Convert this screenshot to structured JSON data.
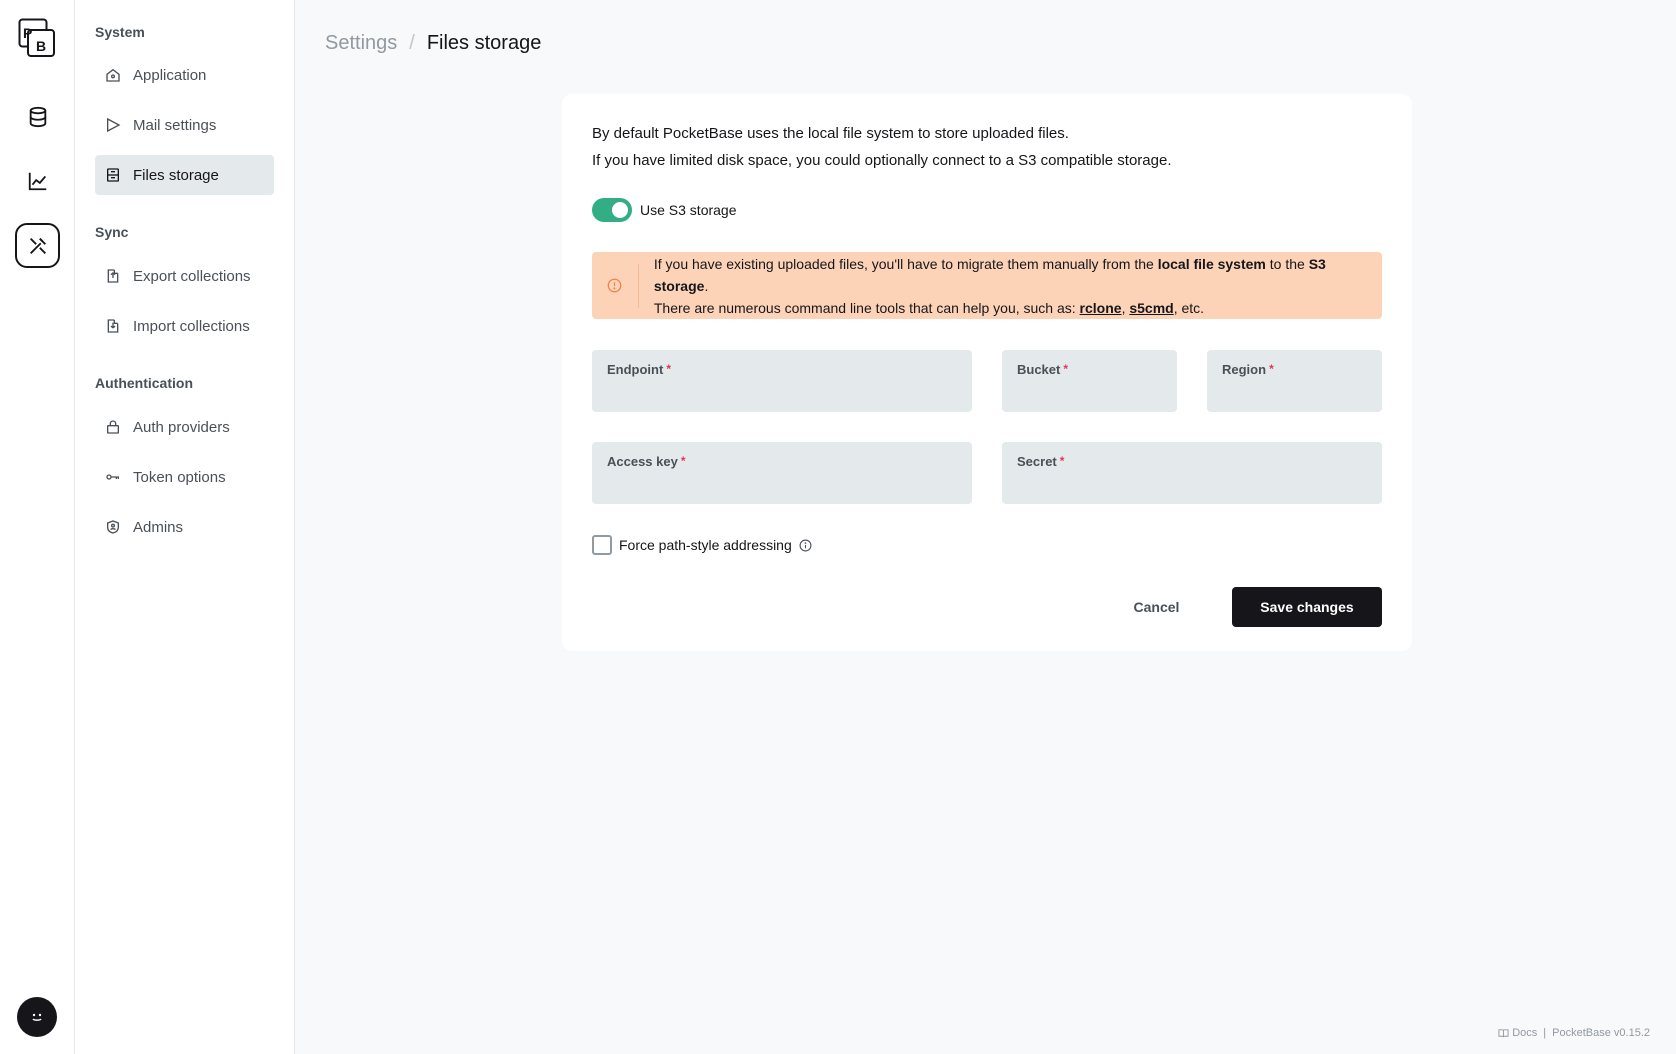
{
  "breadcrumb": {
    "parent": "Settings",
    "separator": "/",
    "current": "Files storage"
  },
  "sidebar": {
    "groups": [
      {
        "label": "System"
      },
      {
        "label": "Sync"
      },
      {
        "label": "Authentication"
      }
    ],
    "items": [
      {
        "label": "Application",
        "icon": "home-icon"
      },
      {
        "label": "Mail settings",
        "icon": "send-icon"
      },
      {
        "label": "Files storage",
        "icon": "archive-icon",
        "active": true
      },
      {
        "label": "Export collections",
        "icon": "export-icon"
      },
      {
        "label": "Import collections",
        "icon": "import-icon"
      },
      {
        "label": "Auth providers",
        "icon": "lock-icon"
      },
      {
        "label": "Token options",
        "icon": "key-icon"
      },
      {
        "label": "Admins",
        "icon": "shield-user-icon"
      }
    ]
  },
  "rail": {
    "logo_text_top": "P",
    "logo_text_bottom": "B",
    "items": [
      "database-icon",
      "chart-icon",
      "tools-icon"
    ]
  },
  "panel": {
    "intro_line1": "By default PocketBase uses the local file system to store uploaded files.",
    "intro_line2": "If you have limited disk space, you could optionally connect to a S3 compatible storage.",
    "toggle_label": "Use S3 storage",
    "toggle_on": true,
    "alert": {
      "t1": "If you have existing uploaded files, you'll have to migrate them manually from the ",
      "b1": "local file system",
      "t2": " to the ",
      "b2": "S3 storage",
      "t3": ".",
      "t4": "There are numerous command line tools that can help you, such as: ",
      "link1": "rclone",
      "t5": ", ",
      "link2": "s5cmd",
      "t6": ", etc."
    },
    "fields": {
      "endpoint": {
        "label": "Endpoint",
        "value": ""
      },
      "bucket": {
        "label": "Bucket",
        "value": ""
      },
      "region": {
        "label": "Region",
        "value": ""
      },
      "access_key": {
        "label": "Access key",
        "value": ""
      },
      "secret": {
        "label": "Secret",
        "value": ""
      }
    },
    "required_mark": "*",
    "force_path_label": "Force path-style addressing",
    "cancel_label": "Cancel",
    "save_label": "Save changes"
  },
  "footer": {
    "docs": "Docs",
    "sep": "|",
    "version": "PocketBase v0.15.2"
  },
  "colors": {
    "accent": "#32ad84",
    "alert_bg": "#fdd3b8",
    "primary": "#16161a"
  }
}
